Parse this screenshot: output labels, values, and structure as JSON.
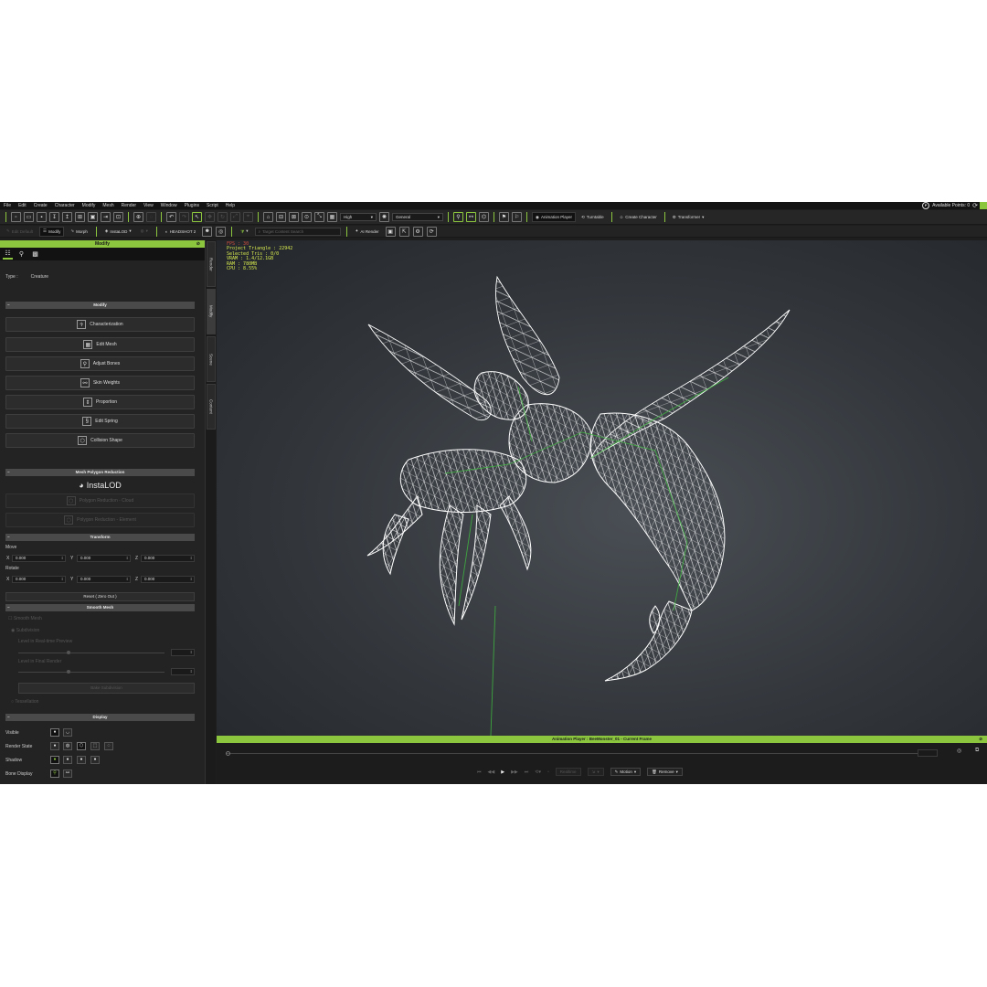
{
  "menu": [
    "File",
    "Edit",
    "Create",
    "Character",
    "Modify",
    "Mesh",
    "Render",
    "View",
    "Window",
    "Plugins",
    "Script",
    "Help"
  ],
  "account": {
    "points_label": "Available Points: 0",
    "badge": "P"
  },
  "toolbar": {
    "quality": "High",
    "shading": "General",
    "animation_player": "Animation Player",
    "turntable": "Turntable",
    "create_character": "Create Character",
    "transformer": "Transformer"
  },
  "toolbar2": {
    "edit_label": "Edit Default",
    "modify": "Modify",
    "morph": "Morph",
    "instalod": "InstaLOD",
    "headshot": "HEADSHOT 2",
    "search_placeholder": "Target Content Search",
    "ai_render": "AI Render"
  },
  "panel": {
    "title": "Modify",
    "type_label": "Type :",
    "type_value": "Creature",
    "modify_section": "Modify",
    "modify_buttons": {
      "characterization": "Characterization",
      "edit_mesh": "Edit Mesh",
      "adjust_bones": "Adjust Bones",
      "skin_weights": "Skin Weights",
      "proportion": "Proportion",
      "edit_spring": "Edit Spring",
      "collision_shape": "Collision Shape"
    },
    "mesh_reduction_section": "Mesh Polygon Reduction",
    "instalod_logo": "InstaLOD",
    "reduction_cloud": "Polygon Reduction - Cloud",
    "reduction_element": "Polygon Reduction - Element",
    "transform_section": "Transform",
    "move_label": "Move",
    "rotate_label": "Rotate",
    "axis_x": "X",
    "axis_y": "Y",
    "axis_z": "Z",
    "move_x": "0.000",
    "move_y": "0.000",
    "move_z": "0.000",
    "rotate_x": "0.000",
    "rotate_y": "0.000",
    "rotate_z": "0.000",
    "reset_label": "Reset ( Zero Out )",
    "smooth_section": "Smooth Mesh",
    "smooth_mesh": "Smooth Mesh",
    "subdivision": "Subdivision",
    "subd_view": "Level in Real-time Preview",
    "subd_final": "Level in Final Render",
    "bake_label": "Bake Subdivision",
    "tessellation": "Tessellation",
    "display_section": "Display",
    "visible_label": "Visible",
    "render_state_label": "Render State",
    "shadow_label": "Shadow",
    "bone_display_label": "Bone Display"
  },
  "side_tabs": [
    "Render",
    "Modify",
    "Scene",
    "Content"
  ],
  "viewport_stats": [
    "FPS : 30",
    "Project Triangle : 22942",
    "Selected Tris : 0/0",
    "VRAM : 1.4/12.1GB",
    "RAM : 780MB",
    "CPU : 8.55%"
  ],
  "animation_player": {
    "title": "Animation Player : BeeMonster_01 - Current Frame",
    "realtime": "Realtime",
    "motion": "Motion",
    "remove": "Remove"
  },
  "colors": {
    "accent": "#8cc63f",
    "stats": "#d7ea4f",
    "viewport": "#3a3e43"
  }
}
